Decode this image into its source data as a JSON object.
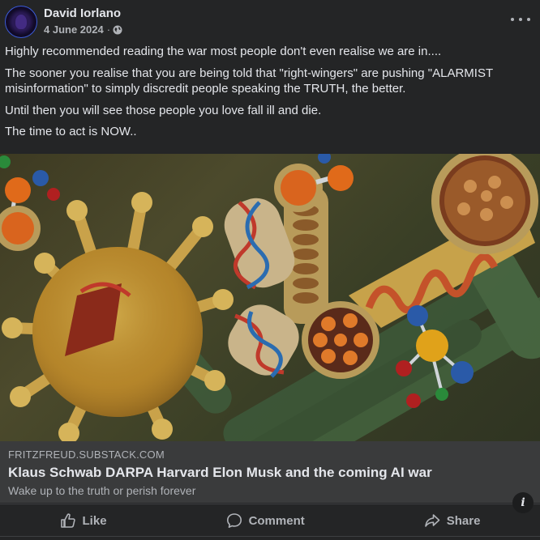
{
  "post": {
    "author": "David Iorlano",
    "date": "4 June 2024",
    "separator": "·",
    "privacy_icon": "globe-icon",
    "menu_icon": "more-options-icon",
    "paragraphs": [
      "Highly recommended reading the war most people don't even realise we are in....",
      "The sooner you realise that you are being told that \"right-wingers\" are pushing \"ALARMIST misinformation\" to simply discredit people speaking the TRUTH, the better.",
      "Until then you will see those people you love fall ill and die.",
      "The time to act is NOW.."
    ]
  },
  "link": {
    "domain": "FRITZFREUD.SUBSTACK.COM",
    "title": "Klaus Schwab DARPA Harvard Elon Musk and the coming AI war",
    "description": "Wake up to the truth or perish forever",
    "info_label": "i"
  },
  "actions": {
    "like": "Like",
    "comment": "Comment",
    "share": "Share"
  },
  "colors": {
    "background": "#242526",
    "link_card": "#3a3b3c",
    "text_primary": "#e4e6eb",
    "text_secondary": "#b0b3b8"
  }
}
